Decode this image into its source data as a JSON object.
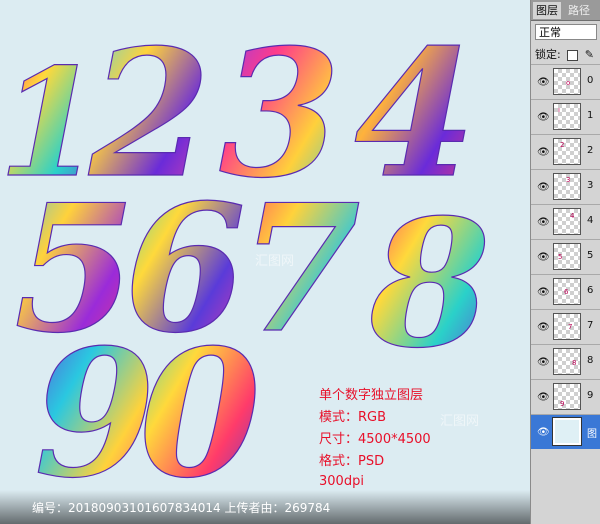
{
  "canvas": {
    "info_lines": [
      "单个数字独立图层",
      "模式：RGB",
      "尺寸：4500*4500",
      "格式：PSD",
      "300dpi"
    ],
    "footer": "编号：20180903101607834014 上传者由：269784",
    "watermark": "汇图网"
  },
  "digits": [
    {
      "char": "1",
      "colors": [
        "#ff2a6d",
        "#ffd93b",
        "#2ad1c9",
        "#6a3bd9"
      ]
    },
    {
      "char": "2",
      "colors": [
        "#3bd3ff",
        "#ffd23b",
        "#6a2bd9",
        "#ff4aa0"
      ]
    },
    {
      "char": "3",
      "colors": [
        "#7a3bff",
        "#ff3b8a",
        "#ffd03b",
        "#2ac8e0"
      ]
    },
    {
      "char": "4",
      "colors": [
        "#2ac8e0",
        "#ffb23b",
        "#6a2bd9",
        "#ff3b6a"
      ]
    },
    {
      "char": "5",
      "colors": [
        "#3bbcff",
        "#ffd23b",
        "#9a2bd9",
        "#ff3b6a"
      ]
    },
    {
      "char": "6",
      "colors": [
        "#2ad1c9",
        "#ffd93b",
        "#5a3bd9",
        "#ff3ba0"
      ]
    },
    {
      "char": "7",
      "colors": [
        "#ff3b6a",
        "#ffd23b",
        "#2ac8e0",
        "#8a3bd9"
      ]
    },
    {
      "char": "8",
      "colors": [
        "#ff2a6d",
        "#ffd93b",
        "#2ad1c9",
        "#6a3bd9"
      ]
    },
    {
      "char": "9",
      "colors": [
        "#6a3bd9",
        "#2ac8e0",
        "#ffd23b",
        "#ff3b8a"
      ]
    },
    {
      "char": "0",
      "colors": [
        "#2ad1c9",
        "#ffd93b",
        "#ff3b6a",
        "#4a3bd9"
      ]
    }
  ],
  "panel": {
    "tabs": [
      "图层",
      "路径"
    ],
    "blend_mode": "正常",
    "lock_label": "锁定:",
    "layers": [
      {
        "name": "0"
      },
      {
        "name": "1"
      },
      {
        "name": "2"
      },
      {
        "name": "3"
      },
      {
        "name": "4"
      },
      {
        "name": "5"
      },
      {
        "name": "6"
      },
      {
        "name": "7"
      },
      {
        "name": "8"
      },
      {
        "name": "9"
      },
      {
        "name": "图"
      }
    ]
  }
}
